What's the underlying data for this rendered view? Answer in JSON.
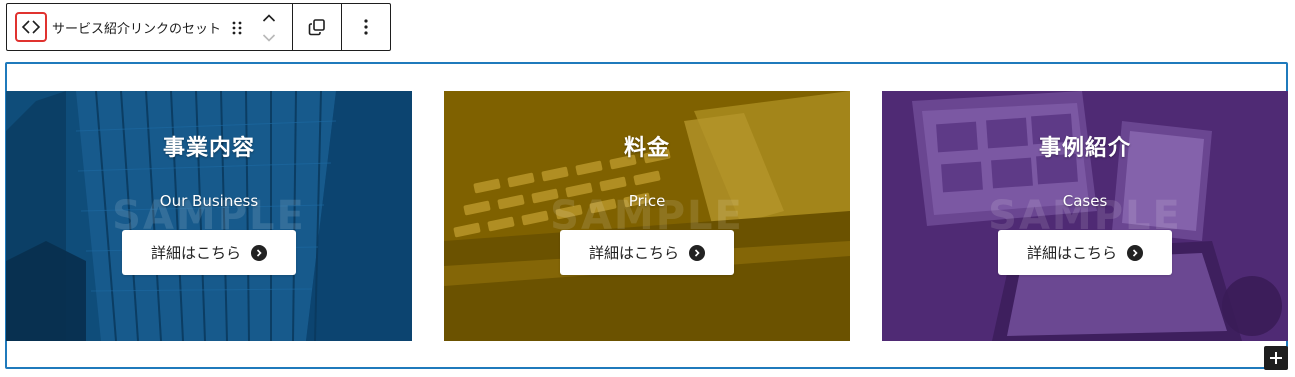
{
  "toolbar": {
    "block_icon": "code-diamond-icon",
    "block_title": "サービス紹介リンクのセット",
    "drag_icon": "drag-handle-icon",
    "move_up_icon": "chevron-up-icon",
    "move_down_icon": "chevron-down-icon",
    "duplicate_icon": "duplicate-icon",
    "more_icon": "more-vertical-icon"
  },
  "cards": [
    {
      "title": "事業内容",
      "subtitle": "Our Business",
      "button_label": "詳細はこちら",
      "overlay_color": "#0f4d7a",
      "watermark": "SAMPLE"
    },
    {
      "title": "料金",
      "subtitle": "Price",
      "button_label": "詳細はこちら",
      "overlay_color": "#7f6100",
      "watermark": "SAMPLE"
    },
    {
      "title": "事例紹介",
      "subtitle": "Cases",
      "button_label": "詳細はこちら",
      "overlay_color": "#4f2a74",
      "watermark": "SAMPLE"
    }
  ],
  "colors": {
    "selection_border": "#1f7abc",
    "active_icon_border": "#e0322f",
    "toolbar_border": "#1e1e1e"
  },
  "add_block_icon": "plus-icon"
}
